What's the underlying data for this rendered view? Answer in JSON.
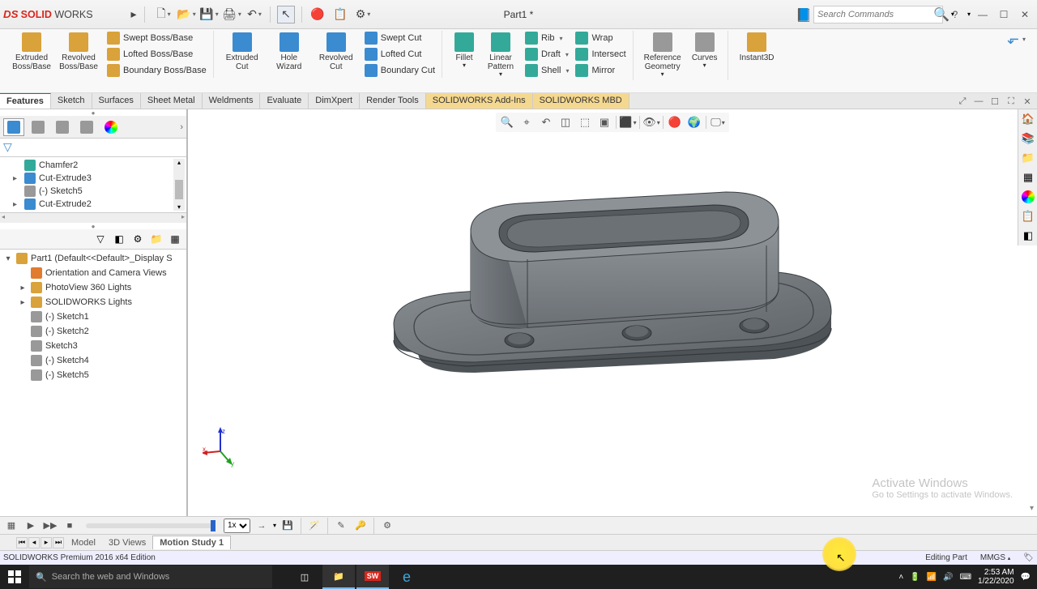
{
  "title": "Part1 *",
  "search_placeholder": "Search Commands",
  "ribbon": {
    "extruded_boss": "Extruded Boss/Base",
    "revolved_boss": "Revolved Boss/Base",
    "swept_boss": "Swept Boss/Base",
    "lofted_boss": "Lofted Boss/Base",
    "boundary_boss": "Boundary Boss/Base",
    "extruded_cut": "Extruded Cut",
    "hole_wizard": "Hole Wizard",
    "revolved_cut": "Revolved Cut",
    "swept_cut": "Swept Cut",
    "lofted_cut": "Lofted Cut",
    "boundary_cut": "Boundary Cut",
    "fillet": "Fillet",
    "linear_pattern": "Linear Pattern",
    "rib": "Rib",
    "draft": "Draft",
    "shell": "Shell",
    "wrap": "Wrap",
    "intersect": "Intersect",
    "mirror": "Mirror",
    "ref_geom": "Reference Geometry",
    "curves": "Curves",
    "instant3d": "Instant3D"
  },
  "tabs": [
    "Features",
    "Sketch",
    "Surfaces",
    "Sheet Metal",
    "Weldments",
    "Evaluate",
    "DimXpert",
    "Render Tools",
    "SOLIDWORKS Add-Ins",
    "SOLIDWORKS MBD"
  ],
  "active_tab": "Features",
  "tree_top": [
    {
      "label": "Chamfer2",
      "expandable": false
    },
    {
      "label": "Cut-Extrude3",
      "expandable": true
    },
    {
      "label": "(-) Sketch5",
      "expandable": false
    },
    {
      "label": "Cut-Extrude2",
      "expandable": true
    }
  ],
  "tree_main_root": "Part1  (Default<<Default>_Display S",
  "tree_main": [
    {
      "label": "Orientation and Camera Views",
      "indent": 1,
      "expandable": false,
      "icon": "orange"
    },
    {
      "label": "PhotoView 360 Lights",
      "indent": 1,
      "expandable": true,
      "icon": "gold"
    },
    {
      "label": "SOLIDWORKS Lights",
      "indent": 1,
      "expandable": true,
      "icon": "gold"
    },
    {
      "label": "(-) Sketch1",
      "indent": 1,
      "expandable": false,
      "icon": "gray"
    },
    {
      "label": "(-) Sketch2",
      "indent": 1,
      "expandable": false,
      "icon": "gray"
    },
    {
      "label": "Sketch3",
      "indent": 1,
      "expandable": false,
      "icon": "gray"
    },
    {
      "label": "(-) Sketch4",
      "indent": 1,
      "expandable": false,
      "icon": "gray"
    },
    {
      "label": "(-) Sketch5",
      "indent": 1,
      "expandable": false,
      "icon": "gray"
    }
  ],
  "motion_speed": "1x",
  "bottom_tabs": [
    "Model",
    "3D Views",
    "Motion Study 1"
  ],
  "active_bottom_tab": "Motion Study 1",
  "status_left": "SOLIDWORKS Premium 2016 x64 Edition",
  "status_mode": "Editing Part",
  "status_units": "MMGS",
  "watermark_title": "Activate Windows",
  "watermark_sub": "Go to Settings to activate Windows.",
  "taskbar_search": "Search the web and Windows",
  "clock_time": "2:53 AM",
  "clock_date": "1/22/2020"
}
